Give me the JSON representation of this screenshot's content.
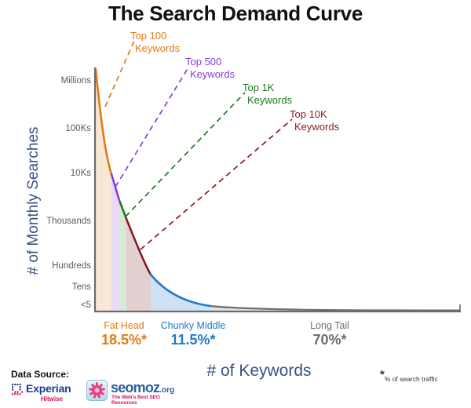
{
  "chart_data": {
    "type": "area",
    "title": "The Search Demand Curve",
    "xlabel": "# of Keywords",
    "ylabel": "# of Monthly Searches",
    "grid": false,
    "legend_position": "inline-callouts",
    "ytick_labels": [
      "Millions",
      "100Ks",
      "10Ks",
      "Thousands",
      "Hundreds",
      "Tens",
      "<5"
    ],
    "curve_description": "Long-tail power-law decay of monthly search volume versus keyword rank",
    "segments": [
      {
        "id": "top-100",
        "callout_line1": "Top 100",
        "callout_line2": "Keywords",
        "color": "#E07B16",
        "band_fill": "#F7E7D5",
        "x_start_pct": 0.0,
        "x_end_pct": 4.3,
        "y_start_label": "Millions",
        "y_end_label": "100Ks"
      },
      {
        "id": "top-500",
        "callout_line1": "Top 500",
        "callout_line2": "Keywords",
        "color": "#8B3DD8",
        "band_fill": "#E9DAF7",
        "x_start_pct": 4.3,
        "x_end_pct": 6.7,
        "y_start_label": "100Ks",
        "y_end_label": "10Ks"
      },
      {
        "id": "top-1k",
        "callout_line1": "Top 1K",
        "callout_line2": "Keywords",
        "color": "#1E7A1E",
        "band_fill": "#D9E8D7",
        "x_start_pct": 6.7,
        "x_end_pct": 8.4,
        "y_start_label": "10Ks",
        "y_end_label": "10Ks"
      },
      {
        "id": "top-10k",
        "callout_line1": "Top 10K",
        "callout_line2": "Keywords",
        "color": "#8B1A1A",
        "band_fill": "#E2D0D0",
        "x_start_pct": 8.4,
        "x_end_pct": 15.3,
        "y_start_label": "10Ks",
        "y_end_label": "Hundreds"
      },
      {
        "id": "chunky-middle-curve",
        "callout_line1": "",
        "callout_line2": "",
        "color": "#1F7BC8",
        "band_fill": "#CFE2F5",
        "x_start_pct": 15.3,
        "x_end_pct": 31.6,
        "y_start_label": "Hundreds",
        "y_end_label": "Tens"
      },
      {
        "id": "long-tail-curve",
        "callout_line1": "",
        "callout_line2": "",
        "color": "#6E6E6E",
        "band_fill": "#E0E0E0",
        "x_start_pct": 31.6,
        "x_end_pct": 100.0,
        "y_start_label": "Tens",
        "y_end_label": "<5"
      }
    ],
    "traffic_breakdown": [
      {
        "id": "fat-head",
        "name": "Fat Head",
        "pct": "18.5%*",
        "color": "#E07B16"
      },
      {
        "id": "chunky-middle",
        "name": "Chunky Middle",
        "pct": "11.5%*",
        "color": "#1F7BC8"
      },
      {
        "id": "long-tail",
        "name": "Long Tail",
        "pct": "70%*",
        "color": "#6E6E6E"
      }
    ]
  },
  "footer": {
    "data_source_label": "Data Source:",
    "experian": {
      "word": "Experian",
      "sub": "Hitwise"
    },
    "seomoz": {
      "word": "seomoz",
      "tld": ".org",
      "tagline": "The Web's Best SEO Resources"
    },
    "footnote_star": "*",
    "footnote_text": "% of search traffic"
  },
  "colors": {
    "axis_text": "#5a5a5a",
    "axis_title": "#3a5283",
    "title": "#111111"
  }
}
